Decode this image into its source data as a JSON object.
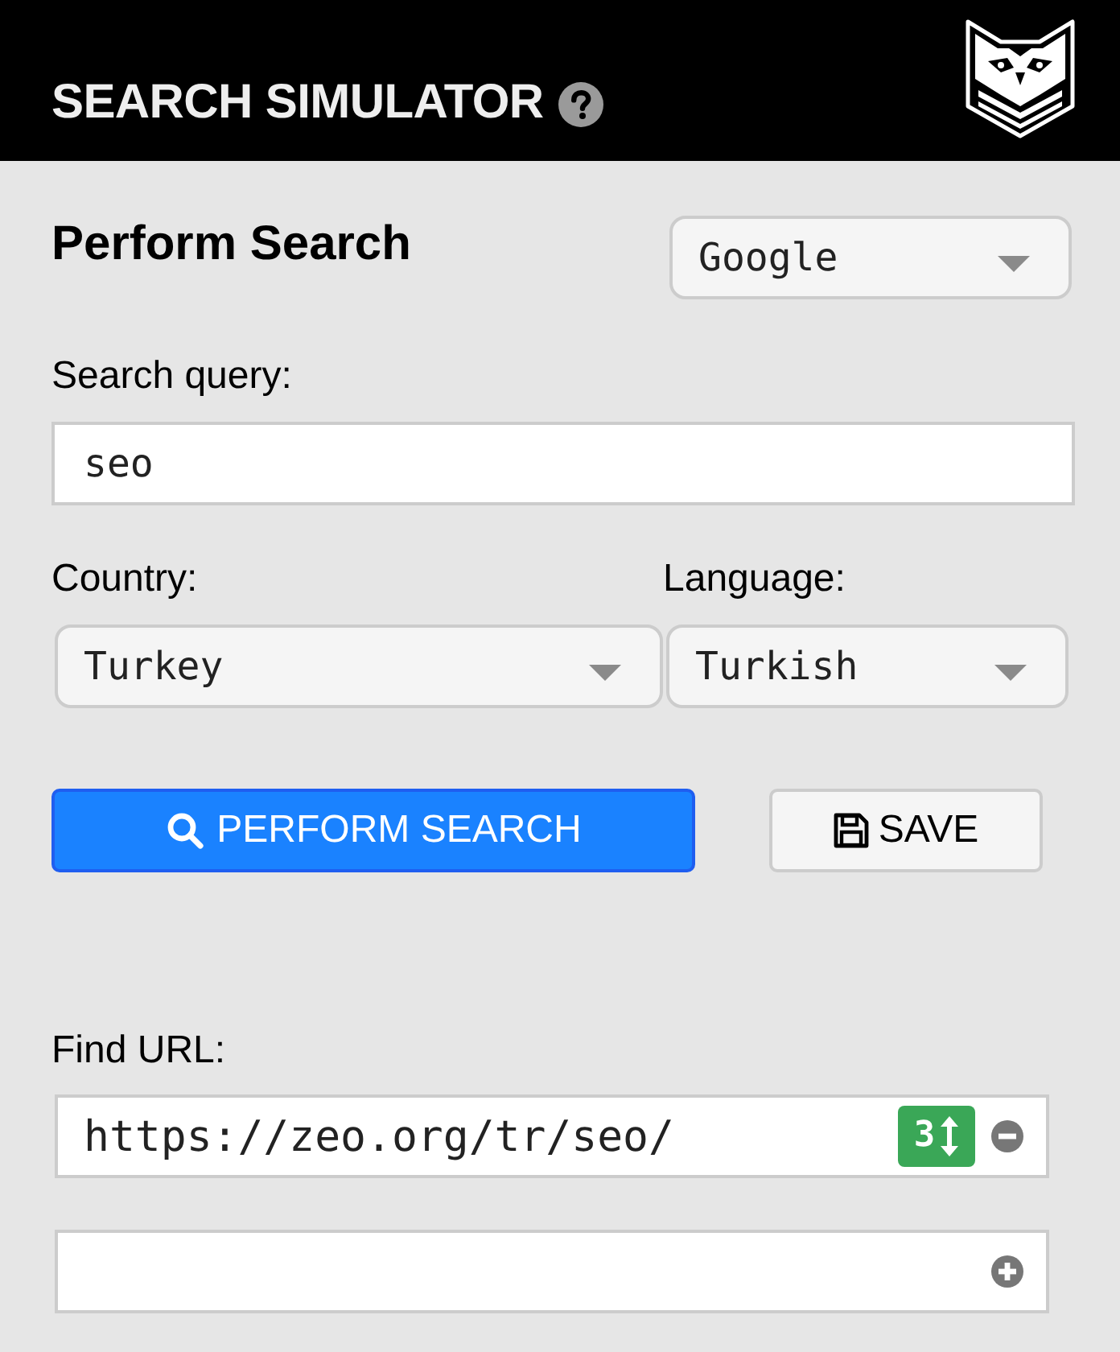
{
  "header": {
    "title": "SEARCH SIMULATOR"
  },
  "perform_search": {
    "heading": "Perform Search",
    "engine_select": {
      "value": "Google"
    },
    "query": {
      "label": "Search query:",
      "value": "seo"
    },
    "country": {
      "label": "Country:",
      "value": "Turkey"
    },
    "language": {
      "label": "Language:",
      "value": "Turkish"
    },
    "buttons": [
      {
        "kind": "primary",
        "label": "PERFORM SEARCH"
      },
      {
        "kind": "secondary",
        "label": "SAVE"
      }
    ]
  },
  "find_url": {
    "label": "Find URL:",
    "entries": [
      {
        "kind": "url",
        "value": "https://zeo.org/tr/seo/",
        "badge": "3"
      },
      {
        "kind": "new"
      }
    ]
  }
}
